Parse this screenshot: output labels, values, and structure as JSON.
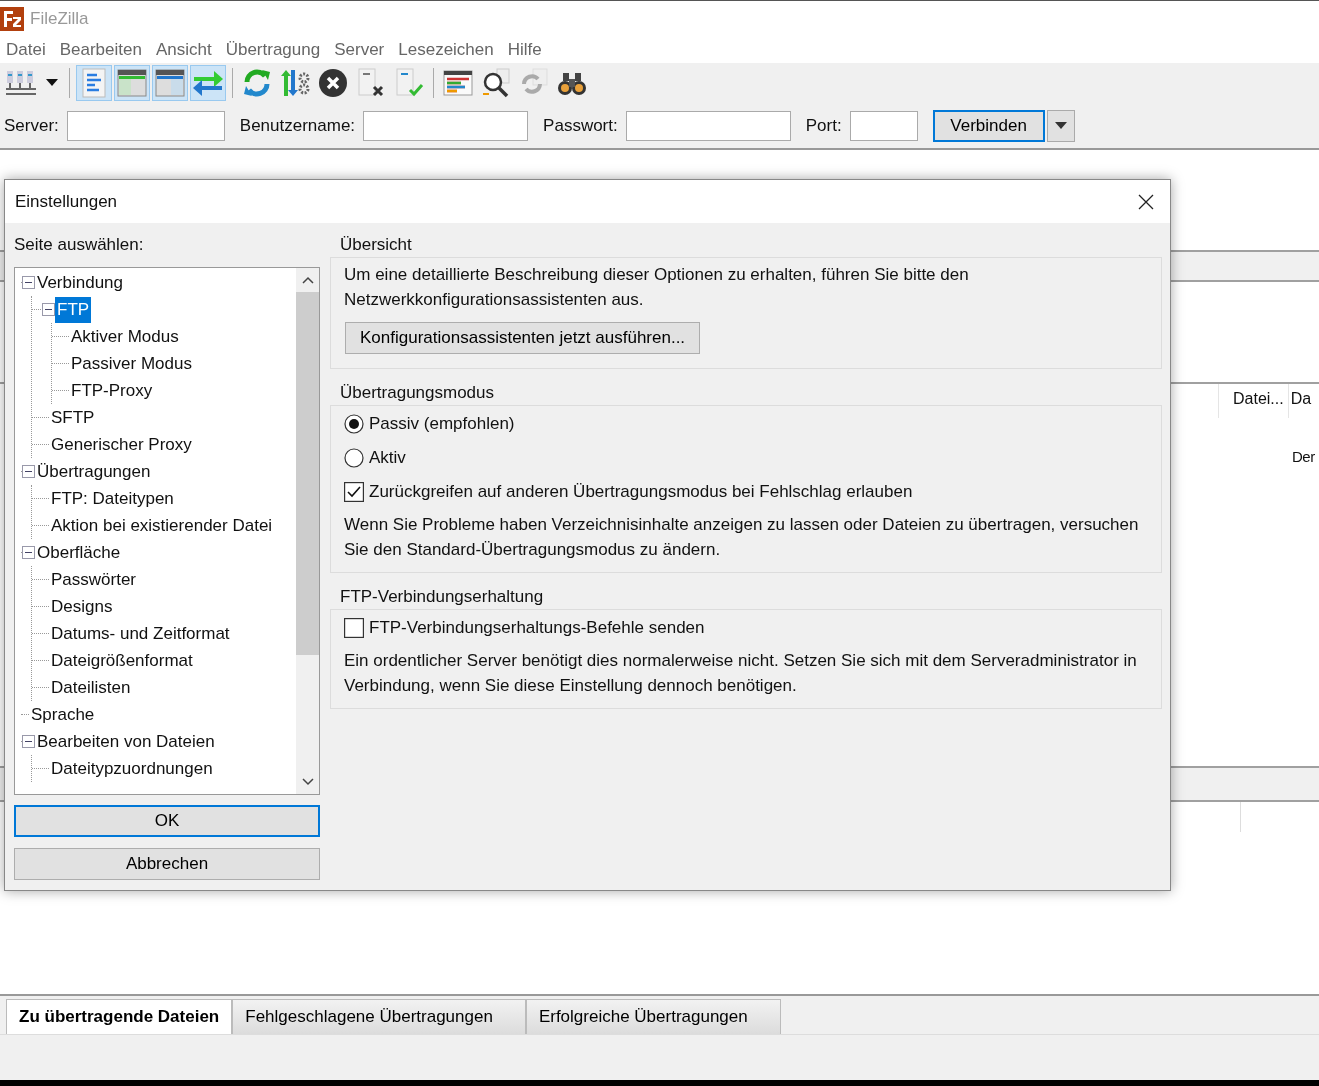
{
  "window": {
    "title": "FileZilla"
  },
  "menu": [
    "Datei",
    "Bearbeiten",
    "Ansicht",
    "Übertragung",
    "Server",
    "Lesezeichen",
    "Hilfe"
  ],
  "toolbar": [
    {
      "kind": "site-manager",
      "on": false
    },
    {
      "kind": "dropdown",
      "on": false
    },
    {
      "kind": "message-log",
      "on": true
    },
    {
      "kind": "local-tree",
      "on": true
    },
    {
      "kind": "remote-tree",
      "on": true
    },
    {
      "kind": "queue",
      "on": true
    },
    {
      "kind": "refresh",
      "on": false
    },
    {
      "kind": "process-queue",
      "on": false
    },
    {
      "kind": "cancel",
      "on": false
    },
    {
      "kind": "disconnect",
      "on": false
    },
    {
      "kind": "reconnect",
      "on": false
    },
    {
      "kind": "filter",
      "on": false
    },
    {
      "kind": "compare",
      "on": false
    },
    {
      "kind": "sync",
      "on": false
    },
    {
      "kind": "search",
      "on": false
    }
  ],
  "quickconnect": {
    "fields": [
      {
        "label": "Server:",
        "kind": "host"
      },
      {
        "label": "Benutzername:",
        "kind": "user"
      },
      {
        "label": "Passwort:",
        "kind": "pass"
      },
      {
        "label": "Port:",
        "kind": "port"
      }
    ],
    "button": "Verbinden"
  },
  "background": {
    "headers": [
      "Datei...",
      "Da"
    ],
    "text": "Der"
  },
  "dialog": {
    "title": "Einstellungen",
    "page_label": "Seite auswählen:",
    "tree": [
      {
        "label": "Verbindung",
        "selected": false,
        "expanded": true,
        "children": [
          {
            "label": "FTP",
            "selected": true,
            "expanded": true,
            "children": [
              {
                "label": "Aktiver Modus",
                "selected": false
              },
              {
                "label": "Passiver Modus",
                "selected": false
              },
              {
                "label": "FTP-Proxy",
                "selected": false
              }
            ]
          },
          {
            "label": "SFTP",
            "selected": false
          },
          {
            "label": "Generischer Proxy",
            "selected": false
          }
        ]
      },
      {
        "label": "Übertragungen",
        "selected": false,
        "expanded": true,
        "children": [
          {
            "label": "FTP: Dateitypen",
            "selected": false
          },
          {
            "label": "Aktion bei existierender Datei",
            "selected": false
          }
        ]
      },
      {
        "label": "Oberfläche",
        "selected": false,
        "expanded": true,
        "children": [
          {
            "label": "Passwörter",
            "selected": false
          },
          {
            "label": "Designs",
            "selected": false
          },
          {
            "label": "Datums- und Zeitformat",
            "selected": false
          },
          {
            "label": "Dateigrößenformat",
            "selected": false
          },
          {
            "label": "Dateilisten",
            "selected": false
          }
        ]
      },
      {
        "label": "Sprache",
        "selected": false
      },
      {
        "label": "Bearbeiten von Dateien",
        "selected": false,
        "expanded": true,
        "children": [
          {
            "label": "Dateitypzuordnungen",
            "selected": false
          }
        ]
      }
    ],
    "buttons": [
      {
        "label": "OK",
        "default": true
      },
      {
        "label": "Abbrechen",
        "default": false
      }
    ],
    "sections": [
      {
        "title": "Übersicht",
        "items": [
          {
            "kind": "text",
            "text": "Um eine detaillierte Beschreibung dieser Optionen zu erhalten, führen Sie bitte den Netzwerkkonfigurationsassistenten aus."
          },
          {
            "kind": "button",
            "text": "Konfigurationsassistenten jetzt ausführen..."
          }
        ]
      },
      {
        "title": "Übertragungsmodus",
        "items": [
          {
            "kind": "radio",
            "text": "Passiv (empfohlen)",
            "selected": true
          },
          {
            "kind": "radio",
            "text": "Aktiv",
            "selected": false
          },
          {
            "kind": "checkbox",
            "text": "Zurückgreifen auf anderen Übertragungsmodus bei Fehlschlag erlauben",
            "checked": true
          },
          {
            "kind": "text",
            "text": "Wenn Sie Probleme haben Verzeichnisinhalte anzeigen zu lassen oder Dateien zu übertragen, versuchen Sie den Standard-Übertragungsmodus zu ändern."
          }
        ]
      },
      {
        "title": "FTP-Verbindungserhaltung",
        "items": [
          {
            "kind": "checkbox",
            "text": "FTP-Verbindungserhaltungs-Befehle senden",
            "checked": false
          },
          {
            "kind": "text",
            "text": "Ein ordentlicher Server benötigt dies normalerweise nicht. Setzen Sie sich mit dem Serveradministrator in Verbindung, wenn Sie diese Einstellung dennoch benötigen."
          }
        ]
      }
    ]
  },
  "queue_tabs": [
    {
      "label": "Zu übertragende Dateien",
      "selected": true
    },
    {
      "label": "Fehlgeschlagene Übertragungen",
      "selected": false
    },
    {
      "label": "Erfolgreiche Übertragungen",
      "selected": false
    }
  ]
}
